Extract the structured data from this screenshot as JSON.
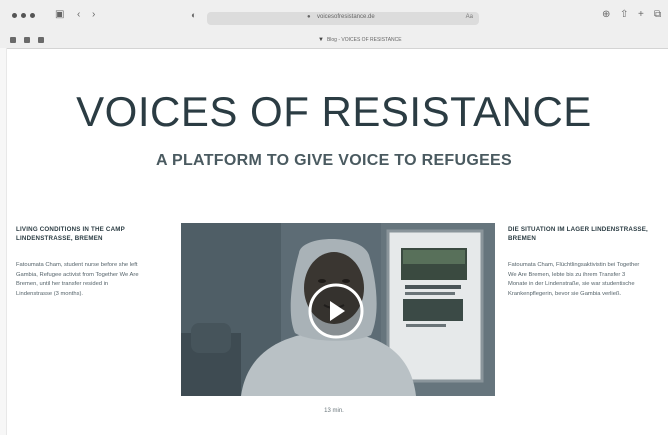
{
  "browser": {
    "url": "voicesofresistance.de",
    "tab_title": "Blog - VOICES OF RESISTANCE",
    "url_right": "Aa",
    "icons": [
      "sidebar-icon",
      "back-icon",
      "forward-icon",
      "privacy-icon",
      "lock-icon",
      "reload-icon",
      "download-icon",
      "share-icon",
      "new-tab-icon",
      "tab-overview-icon"
    ]
  },
  "page": {
    "title": "VOICES OF RESISTANCE",
    "subtitle": "A PLATFORM TO GIVE VOICE TO REFUGEES"
  },
  "left_column": {
    "heading": "LIVING CONDITIONS IN THE CAMP LINDENSTRASSE, BREMEN",
    "text": "Fatoumata Cham, student nurse before she left Gambia, Refugee activist from Together We Are Bremen, until her transfer resided in Lindenstrasse (3 months)."
  },
  "right_column": {
    "heading": "DIE SITUATION IM LAGER LINDENSTRASSE, BREMEN",
    "text": "Fatoumata Cham, Flüchtlingsaktivistin bei Together We Are Bremen, lebte bis zu ihrem Transfer 3 Monate in der Lindenstraße, sie war studentische Krankenpflegerin, bevor sie Gambia verließ."
  },
  "video": {
    "duration": "13 min.",
    "play_icon": "play-icon"
  },
  "colors": {
    "title": "#2b3c43",
    "subtitle": "#4a5a60",
    "video_bg": "#5b6a73"
  }
}
